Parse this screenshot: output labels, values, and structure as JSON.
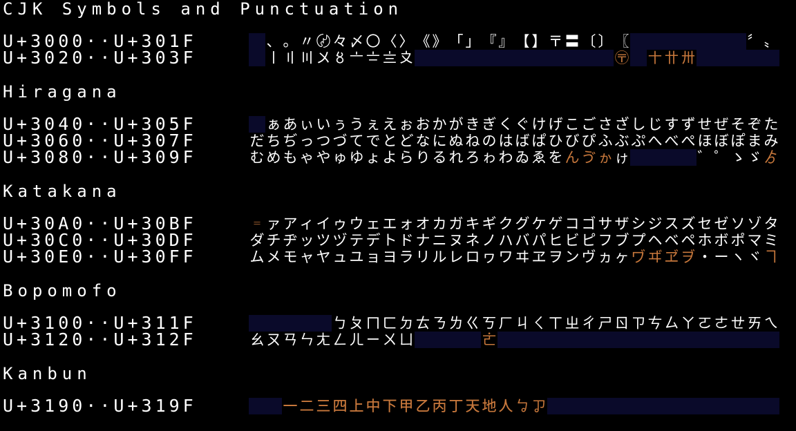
{
  "sections": [
    {
      "title": "CJK Symbols and Punctuation",
      "rows": [
        {
          "range": "U+3000··U+301F",
          "start": 12288,
          "accent": [],
          "missing": [
            0,
            23,
            24,
            25,
            26,
            27,
            28,
            29
          ]
        },
        {
          "range": "U+3020··U+303F",
          "start": 12320,
          "accent": [
            22,
            24,
            25,
            26
          ],
          "missing": [
            0,
            10,
            11,
            12,
            13,
            14,
            15,
            16,
            17,
            18,
            19,
            20,
            21,
            23,
            27,
            28,
            29,
            30,
            31
          ]
        }
      ]
    },
    {
      "title": "Hiragana",
      "rows": [
        {
          "range": "U+3040··U+305F",
          "start": 12352,
          "accent": [],
          "missing": [
            0
          ]
        },
        {
          "range": "U+3060··U+307F",
          "start": 12384,
          "accent": [],
          "missing": []
        },
        {
          "range": "U+3080··U+309F",
          "start": 12416,
          "accent": [
            19,
            20,
            21,
            31
          ],
          "missing": [
            23,
            24,
            25,
            26
          ]
        }
      ]
    },
    {
      "title": "Katakana",
      "rows": [
        {
          "range": "U+30A0··U+30BF",
          "start": 12448,
          "accent": [
            0
          ],
          "missing": []
        },
        {
          "range": "U+30C0··U+30DF",
          "start": 12480,
          "accent": [],
          "missing": []
        },
        {
          "range": "U+30E0··U+30FF",
          "start": 12512,
          "accent": [
            23,
            24,
            25,
            26,
            31
          ],
          "missing": []
        }
      ]
    },
    {
      "title": "Bopomofo",
      "rows": [
        {
          "range": "U+3100··U+311F",
          "start": 12544,
          "accent": [],
          "missing": [
            0,
            1,
            2,
            3,
            4
          ]
        },
        {
          "range": "U+3120··U+312F",
          "start": 12576,
          "accent": [
            14
          ],
          "missing": [
            10,
            11,
            12,
            13,
            15,
            16,
            17,
            18,
            19,
            20,
            21,
            22,
            23,
            24,
            25,
            26,
            27,
            28,
            29,
            30,
            31
          ]
        }
      ]
    },
    {
      "title": "Kanbun",
      "rows": [
        {
          "range": "U+3190··U+319F",
          "start": 12688,
          "accent": [
            2,
            3,
            4,
            5,
            6,
            7,
            8,
            9,
            10,
            11,
            12,
            13,
            14,
            15,
            16,
            17
          ],
          "missing": [
            0,
            1,
            18,
            19,
            20,
            21,
            22,
            23,
            24,
            25,
            26,
            27,
            28,
            29,
            30,
            31
          ]
        }
      ]
    }
  ],
  "colors": {
    "background": "#000000",
    "text": "#ffffff",
    "accent": "#c8783c",
    "missing": "#0a0a2a"
  }
}
